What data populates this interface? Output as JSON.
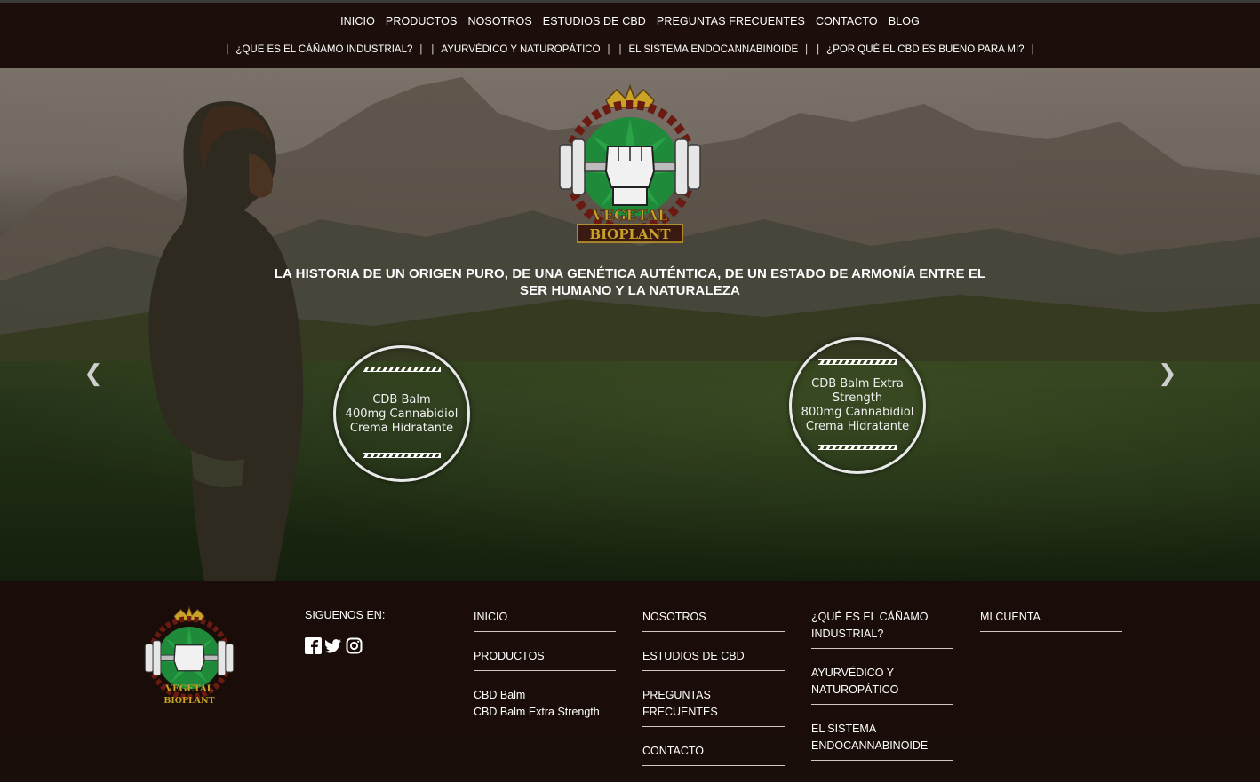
{
  "nav": {
    "main": [
      "INICIO",
      "PRODUCTOS",
      "NOSOTROS",
      "ESTUDIOS DE CBD",
      "PREGUNTAS FRECUENTES",
      "CONTACTO",
      "BLOG"
    ],
    "sub": [
      "¿QUE ES EL CÁÑAMO INDUSTRIAL?",
      "AYURVÉDICO Y NATUROPÁTICO",
      "EL SISTEMA ENDOCANNABINOIDE",
      "¿POR QUÉ EL CBD ES BUENO PARA MI?"
    ],
    "separator": "|"
  },
  "hero": {
    "logo_text_top": "VEGETAL",
    "logo_text_bottom": "BIOPLANT",
    "tagline_line1": "LA HISTORIA DE UN ORIGEN PURO, DE UNA GENÉTICA AUTÉNTICA, DE UN ESTADO DE ARMONÍA ENTRE EL",
    "tagline_line2": "SER HUMANO Y LA NATURALEZA",
    "prev_icon": "chevron-left-icon",
    "next_icon": "chevron-right-icon",
    "products": [
      {
        "lines": [
          "CDB Balm",
          "400mg Cannabidiol",
          "Crema Hidratante"
        ]
      },
      {
        "lines": [
          "CDB Balm Extra",
          "Strength",
          "800mg Cannabidiol",
          "Crema Hidratante"
        ]
      }
    ]
  },
  "footer": {
    "logo_text_top": "VEGETAL",
    "logo_text_bottom": "BIOPLANT",
    "follow_label": "SIGUENOS EN:",
    "social_icons": [
      "facebook-icon",
      "twitter-icon",
      "instagram-icon"
    ],
    "col1": {
      "items": [
        "INICIO",
        "PRODUCTOS"
      ],
      "sublinks": [
        "CBD Balm",
        "CBD Balm Extra Strength"
      ]
    },
    "col2": {
      "items": [
        "NOSOTROS",
        "ESTUDIOS DE CBD",
        "PREGUNTAS FRECUENTES",
        "CONTACTO"
      ]
    },
    "col3": {
      "items": [
        "¿QUÉ ES EL CÁÑAMO INDUSTRIAL?",
        "AYURVÉDICO Y NATUROPÁTICO",
        "EL SISTEMA ENDOCANNABINOIDE"
      ]
    },
    "col4": {
      "items": [
        "MI CUENTA"
      ]
    }
  },
  "colors": {
    "header_bg": "#1c0f0b",
    "footer_bg": "#1a0d09",
    "logo_green": "#1f8a3a",
    "logo_gold": "#c9a227"
  }
}
